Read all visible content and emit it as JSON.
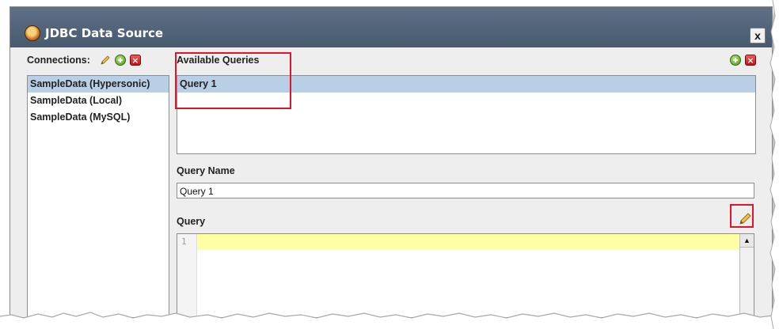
{
  "window": {
    "title": "JDBC Data Source",
    "close_glyph": "x"
  },
  "connections": {
    "label": "Connections:",
    "items": [
      "SampleData (Hypersonic)",
      "SampleData (Local)",
      "SampleData (MySQL)"
    ],
    "selected": "SampleData (Hypersonic)"
  },
  "queries": {
    "label": "Available Queries",
    "items": [
      "Query 1"
    ],
    "selected": "Query 1"
  },
  "query_name": {
    "label": "Query Name",
    "value": "Query 1"
  },
  "query": {
    "label": "Query",
    "line_number": "1",
    "scroll_up_glyph": "▲"
  },
  "icons": {
    "edit": "pencil-icon",
    "add": "add-icon",
    "delete": "delete-icon",
    "delete_glyph": "×",
    "app": "app-icon"
  },
  "colors": {
    "titlebar": "#52657c",
    "selection": "#b8cfe5",
    "highlight_line": "#ffffa3",
    "annotation": "#e0142a"
  }
}
